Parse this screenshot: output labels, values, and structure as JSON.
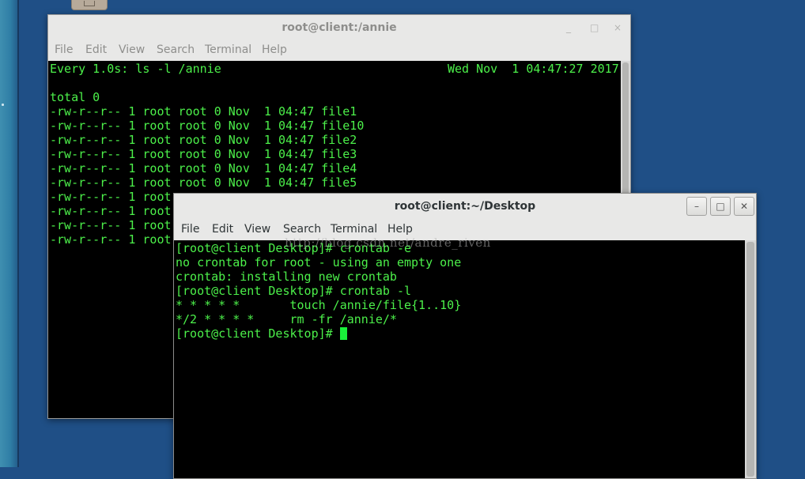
{
  "colors": {
    "terminal_fg": "#4cf04a",
    "terminal_bg": "#000000",
    "desktop_bg": "#1f4f86",
    "cursor": "#19f03a"
  },
  "back_window": {
    "title": "root@client:/annie",
    "controls": [
      "_",
      "□",
      "×"
    ],
    "menu": [
      "File",
      "Edit",
      "View",
      "Search",
      "Terminal",
      "Help"
    ],
    "header_command": "Every 1.0s: ls -l /annie",
    "header_time": "Wed Nov  1 04:47:27 2017",
    "lines": [
      "",
      "total 0",
      "-rw-r--r-- 1 root root 0 Nov  1 04:47 file1",
      "-rw-r--r-- 1 root root 0 Nov  1 04:47 file10",
      "-rw-r--r-- 1 root root 0 Nov  1 04:47 file2",
      "-rw-r--r-- 1 root root 0 Nov  1 04:47 file3",
      "-rw-r--r-- 1 root root 0 Nov  1 04:47 file4",
      "-rw-r--r-- 1 root root 0 Nov  1 04:47 file5",
      "-rw-r--r-- 1 root",
      "-rw-r--r-- 1 root",
      "-rw-r--r-- 1 root",
      "-rw-r--r-- 1 root"
    ]
  },
  "front_window": {
    "title": "root@client:~/Desktop",
    "controls": [
      "–",
      "□",
      "✕"
    ],
    "menu": [
      "File",
      "Edit",
      "View",
      "Search",
      "Terminal",
      "Help"
    ],
    "lines": [
      "[root@client Desktop]# crontab -e",
      "no crontab for root - using an empty one",
      "crontab: installing new crontab",
      "[root@client Desktop]# crontab -l",
      "* * * * *       touch /annie/file{1..10}",
      "*/2 * * * *     rm -fr /annie/*",
      "[root@client Desktop]# "
    ]
  },
  "watermark": "http://blog.csdn.net/andre_riven"
}
